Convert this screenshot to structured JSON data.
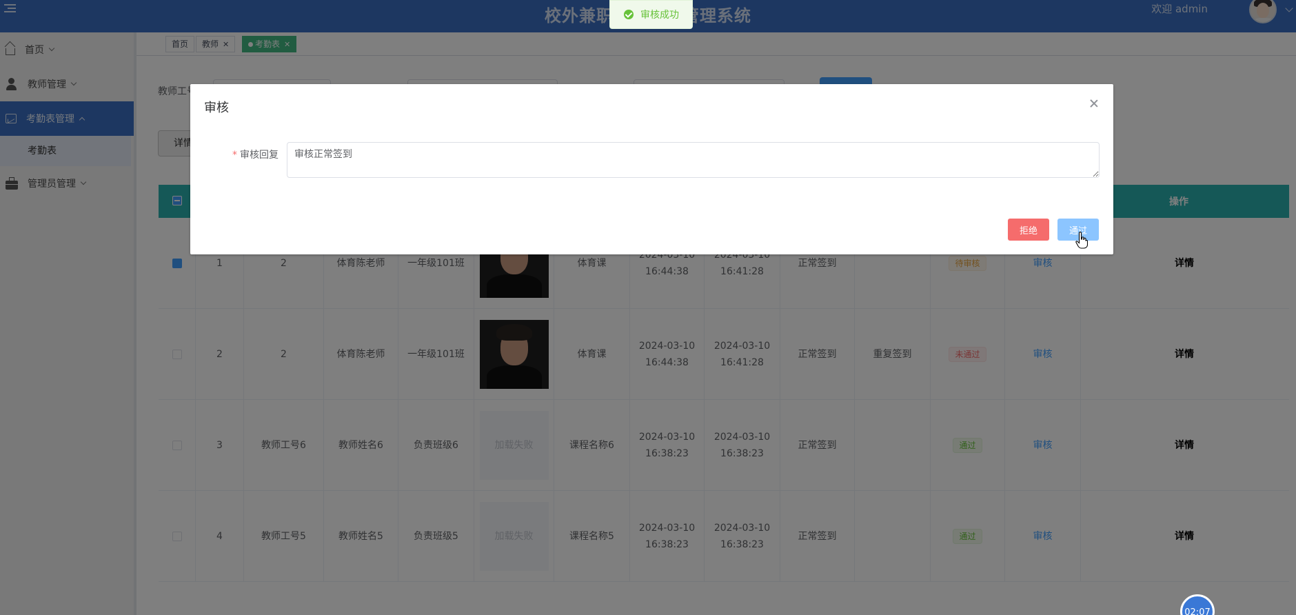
{
  "header": {
    "app_title": "校外兼职教师考勤管理系统",
    "welcome": "欢迎 admin"
  },
  "sidebar": {
    "items": [
      {
        "label": "首页"
      },
      {
        "label": "教师管理"
      },
      {
        "label": "考勤表管理"
      },
      {
        "label": "管理员管理"
      }
    ],
    "sub_item": "考勤表"
  },
  "tabs": [
    {
      "label": "首页"
    },
    {
      "label": "教师"
    },
    {
      "label": "考勤表"
    }
  ],
  "search": {
    "teacher_id_label": "教师工号"
  },
  "toolbar": {
    "detail_label": "详情"
  },
  "table": {
    "ops_header": "操作",
    "rows": [
      {
        "index": "1",
        "teacher_id": "2",
        "teacher_name": "体育陈老师",
        "class": "一年级101班",
        "photo": "photo",
        "course": "体育课",
        "time1": "2024-03-10 16:44:38",
        "time2": "2024-03-10 16:41:28",
        "sign": "正常签到",
        "reply": "",
        "status": "待审核",
        "status_type": "pending",
        "audit": "审核",
        "detail": "详情",
        "checked": true
      },
      {
        "index": "2",
        "teacher_id": "2",
        "teacher_name": "体育陈老师",
        "class": "一年级101班",
        "photo": "photo",
        "course": "体育课",
        "time1": "2024-03-10 16:44:38",
        "time2": "2024-03-10 16:41:28",
        "sign": "正常签到",
        "reply": "重复签到",
        "status": "未通过",
        "status_type": "rejected",
        "audit": "审核",
        "detail": "详情",
        "checked": false
      },
      {
        "index": "3",
        "teacher_id": "教师工号6",
        "teacher_name": "教师姓名6",
        "class": "负责班级6",
        "photo": "加载失败",
        "course": "课程名称6",
        "time1": "2024-03-10 16:38:23",
        "time2": "2024-03-10 16:38:23",
        "sign": "正常签到",
        "reply": "",
        "status": "通过",
        "status_type": "passed",
        "audit": "审核",
        "detail": "详情",
        "checked": false
      },
      {
        "index": "4",
        "teacher_id": "教师工号5",
        "teacher_name": "教师姓名5",
        "class": "负责班级5",
        "photo": "加载失败",
        "course": "课程名称5",
        "time1": "2024-03-10 16:38:23",
        "time2": "2024-03-10 16:38:23",
        "sign": "正常签到",
        "reply": "",
        "status": "通过",
        "status_type": "passed",
        "audit": "审核",
        "detail": "详情",
        "checked": false
      }
    ]
  },
  "toast": {
    "message": "审核成功"
  },
  "dialog": {
    "title": "审核",
    "field_label": "审核回复",
    "reply_value": "审核正常签到",
    "reject_label": "拒绝",
    "pass_label": "通过"
  },
  "timer": {
    "text": "02:07"
  }
}
